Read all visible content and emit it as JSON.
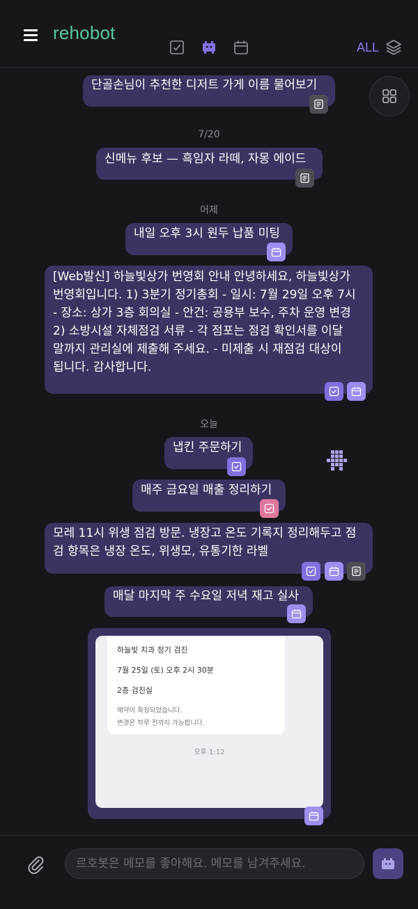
{
  "header": {
    "logo": "rehobot",
    "filter_label": "ALL"
  },
  "messages": [
    {
      "text": "단골손님이 추천한 디저트 가게 이름 물어보기",
      "badges": [
        "note-icon"
      ]
    },
    {
      "date": "7/20"
    },
    {
      "text": "신메뉴 후보 — 흑임자 라떼, 자몽 에이드",
      "badges": [
        "note-icon"
      ]
    },
    {
      "date": "어제"
    },
    {
      "text": "내일 오후 3시 원두 납품 미팅",
      "badges": [
        "calendar-icon"
      ]
    },
    {
      "lines": [
        "[Web발신] 하늘빛상가 번영회 안내 안녕하세요, 하늘빛상가",
        "번영회입니다. 1) 3분기 정기총회 - 일시: 7월 29일 오후 7시",
        "- 장소: 상가 3층 회의실 - 안건: 공용부 보수, 주차 운영 변경",
        "2) 소방시설 자체점검 서류 - 각 점포는 점검 확인서를 이달",
        "말까지 관리실에 제출해 주세요. - 미제출 시 재점검 대상이",
        "됩니다. 감사합니다."
      ],
      "badges": [
        "check-icon",
        "calendar-icon"
      ]
    },
    {
      "date": "오늘"
    },
    {
      "text": "냅킨 주문하기",
      "badges": [
        "check-icon"
      ]
    },
    {
      "text": "매주 금요일 매출 정리하기",
      "badges": [
        "check-icon"
      ]
    },
    {
      "lines": [
        "모레 11시 위생 점검 방문. 냉장고 온도 기록지 정리해두고 점",
        "검 항목은 냉장 온도, 위생모, 유통기한 라벨"
      ],
      "badges": [
        "check-icon",
        "calendar-icon",
        "note-icon"
      ]
    },
    {
      "text": "매달 마지막 주 수요일 저녁 재고 실사",
      "badges": [
        "calendar-icon"
      ]
    }
  ],
  "dates": [
    "7/20",
    "어제",
    "오늘"
  ],
  "m1": "단골손님이 추천한 디저트 가게 이름 물어보기",
  "m2": "신메뉴 후보 — 흑임자 라떼, 자몽 에이드",
  "m3": "내일 오후 3시 원두 납품 미팅",
  "m4": [
    "[Web발신] 하늘빛상가 번영회 안내 안녕하세요, 하늘빛상가",
    "번영회입니다. 1) 3분기 정기총회 - 일시: 7월 29일 오후 7시",
    "- 장소: 상가 3층 회의실 - 안건: 공용부 보수, 주차 운영 변경",
    "2) 소방시설 자체점검 서류 - 각 점포는 점검 확인서를 이달",
    "말까지 관리실에 제출해 주세요. - 미제출 시 재점검 대상이",
    "됩니다. 감사합니다."
  ],
  "m5": "냅킨 주문하기",
  "m6": "매주 금요일 매출 정리하기",
  "m7": [
    "모레 11시 위생 점검 방문. 냉장고 온도 기록지 정리해두고 점",
    "검 항목은 냉장 온도, 위생모, 유통기한 라벨"
  ],
  "m8": "매달 마지막 주 수요일 저녁 재고 실사",
  "card": {
    "title": "하늘빛 치과 정기 검진",
    "datetime": "7월 25일 (토) 오후 2시 30분",
    "location": "2층 검진실",
    "note1": "예약이 확정되었습니다.",
    "note2": "변경은 하루 전까지 가능합니다.",
    "time": "오후 1:12"
  },
  "composer": {
    "placeholder": "르호봇은 메모를 좋아해요. 메모를 남겨주세요."
  },
  "colors": {
    "background": "#17161b",
    "bubble": "#3a3461",
    "accent": "#8270df",
    "logo": "#57c9a0",
    "pink": "#e0779f"
  }
}
